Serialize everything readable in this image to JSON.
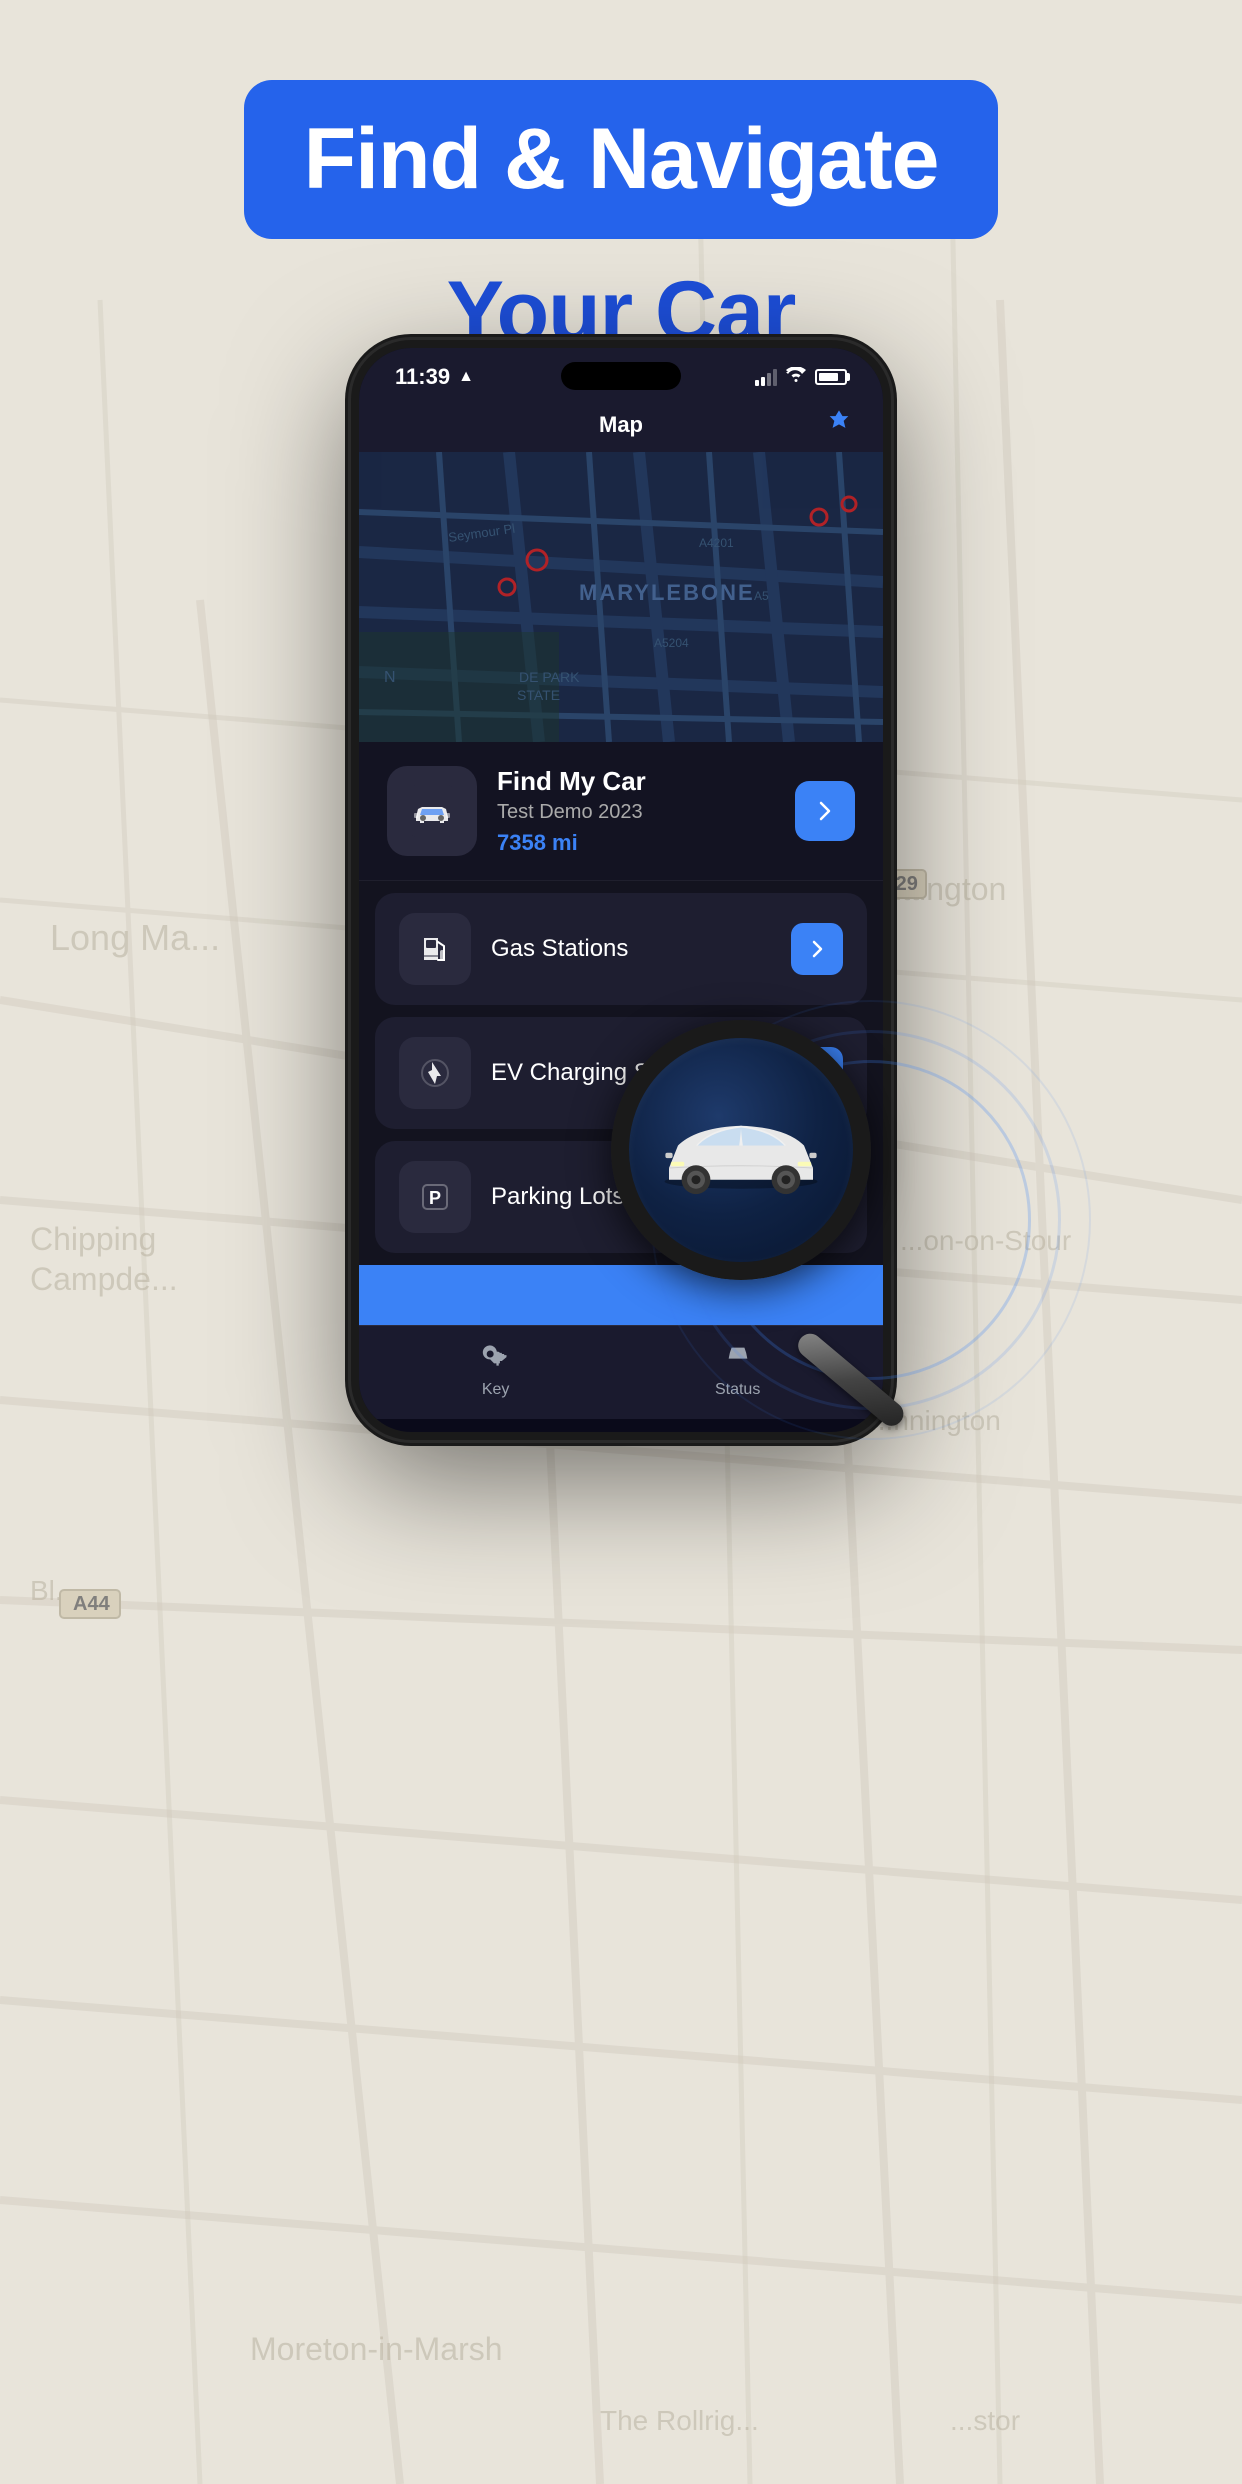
{
  "header": {
    "headline": "Find & Navigate",
    "subheadline": "Your Car"
  },
  "phone": {
    "status_bar": {
      "time": "11:39",
      "location_arrow": "▲"
    },
    "nav": {
      "title": "Map",
      "gem_icon": "◆"
    },
    "map": {
      "location_label": "MARYLEBONE"
    },
    "find_car_card": {
      "title": "Find My Car",
      "subtitle": "Test Demo 2023",
      "mileage": "7358 mi"
    },
    "menu_items": [
      {
        "id": "gas",
        "label": "Gas Stations",
        "icon": "gas"
      },
      {
        "id": "ev",
        "label": "EV Charging Stations",
        "icon": "ev"
      },
      {
        "id": "parking",
        "label": "Parking Lots",
        "icon": "parking"
      }
    ],
    "tab_bar": [
      {
        "id": "key",
        "label": "Key",
        "icon": "key"
      },
      {
        "id": "status",
        "label": "Status",
        "icon": "car"
      }
    ]
  },
  "colors": {
    "blue": "#3b82f6",
    "dark_bg": "#13131f",
    "card_bg": "#1e1e30"
  }
}
